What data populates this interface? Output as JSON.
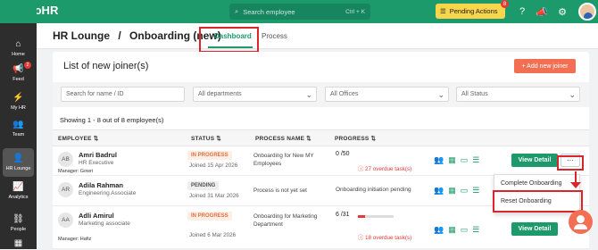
{
  "brand": {
    "name": "brioHR"
  },
  "topbar": {
    "search_placeholder": "Search employee",
    "search_shortcut": "Ctrl + K",
    "pending_label": "Pending Actions",
    "pending_count": "8"
  },
  "sidebar": {
    "items": [
      {
        "label": "Home",
        "icon": "home-icon"
      },
      {
        "label": "Feed",
        "icon": "megaphone-icon",
        "badge": "2"
      },
      {
        "label": "My HR",
        "icon": "lightning-icon"
      },
      {
        "label": "Team",
        "icon": "team-icon"
      },
      {
        "label": "HR Lounge",
        "icon": "users-icon",
        "active": true
      },
      {
        "label": "Analytics",
        "icon": "chart-icon"
      },
      {
        "label": "People",
        "icon": "org-icon"
      }
    ]
  },
  "header": {
    "breadcrumb_root": "HR Lounge",
    "separator": "/",
    "page": "Onboarding (new)",
    "tabs": [
      "Dashboard",
      "Process"
    ]
  },
  "card": {
    "title": "List of new joiner(s)",
    "add_button": "+ Add new joiner",
    "filters": {
      "search_placeholder": "Search for name / ID",
      "departments": "All departments",
      "offices": "All Offices",
      "status": "All Status"
    },
    "showing": "Showing 1 - 8 out of 8 employee(s)",
    "columns": [
      "EMPLOYEE",
      "STATUS",
      "PROCESS NAME",
      "PROGRESS"
    ],
    "rows": [
      {
        "initials": "AB",
        "name": "Amri Badrul",
        "role": "HR Executive",
        "manager": "Manager: Gowri",
        "status": "IN PROGRESS",
        "status_kind": "progress",
        "joined": "Joined 15 Apr 2026",
        "process": "Onboarding for New MY Employees",
        "progress": "0 /50",
        "progress_fraction": 0,
        "overdue": "27 overdue task(s)",
        "view": "View Detail",
        "more": "···"
      },
      {
        "initials": "AR",
        "name": "Adila Rahman",
        "role": "Engineering Associate",
        "manager": "",
        "status": "PENDING",
        "status_kind": "pending",
        "joined": "Joined 31 Mar 2026",
        "process": "Process is not yet set",
        "progress": "Onboarding initiation pending",
        "overdue": "",
        "view": "",
        "more": ""
      },
      {
        "initials": "AA",
        "name": "Adli Amirul",
        "role": "Marketing associate",
        "manager": "Manager: Hafiz",
        "status": "IN PROGRESS",
        "status_kind": "progress",
        "joined": "Joined 6 Mar 2026",
        "process": "Onboarding for Marketing Department",
        "progress": "6 /31",
        "progress_fraction": 0.19,
        "overdue": "18 overdue task(s)",
        "view": "View Detail",
        "more": ""
      }
    ],
    "menu": [
      "Complete Onboarding",
      "Reset Onboarding"
    ]
  }
}
